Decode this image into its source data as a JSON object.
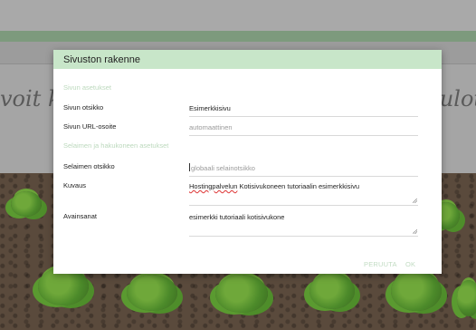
{
  "background": {
    "hero_left": "voit ki",
    "hero_right": "etulot"
  },
  "dialog": {
    "title": "Sivuston rakenne",
    "section_page": "Sivun asetukset",
    "section_browser": "Selaimen ja hakukoneen asetukset",
    "fields": {
      "page_title": {
        "label": "Sivun otsikko",
        "value": "Esimerkkisivu"
      },
      "page_url": {
        "label": "Sivun URL-osoite",
        "placeholder": "automaattinen"
      },
      "browser_title": {
        "label": "Selaimen otsikko",
        "placeholder": "globaali selainotsikko"
      },
      "description": {
        "label": "Kuvaus",
        "value_misspelled": "Hostingpalvelun",
        "value_rest": " Kotisivukoneen tutoriaalin esimerkkisivu"
      },
      "keywords": {
        "label": "Avainsanat",
        "value": "esimerkki tutoriaali kotisivukone"
      }
    },
    "buttons": {
      "cancel": "PERUUTA",
      "ok": "OK"
    }
  },
  "colors": {
    "header_bg": "#c8e6c9",
    "section_heading": "#bcd9bd",
    "button_text": "#c2dcc3"
  }
}
